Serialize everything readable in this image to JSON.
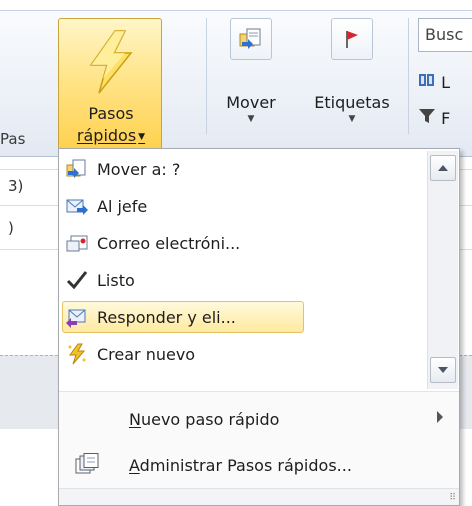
{
  "ribbon": {
    "quick_steps_button": {
      "line1": "Pasos",
      "line2": "rápidos"
    },
    "move_button": {
      "label": "Mover",
      "icon": "move-folder-icon"
    },
    "tags_button": {
      "label": "Etiquetas",
      "icon": "red-flag-icon"
    },
    "group_label": "Pas",
    "search_box": "Busc",
    "side_items": [
      {
        "label": "L",
        "icon": "address-book-icon"
      },
      {
        "label": "F",
        "icon": "filter-icon"
      }
    ]
  },
  "background_rows": [
    "3)",
    ")"
  ],
  "quick_steps_menu": {
    "gallery_items": [
      {
        "label": "Mover a: ?",
        "icon": "move-to-folder-icon"
      },
      {
        "label": "Al jefe",
        "icon": "forward-mail-icon"
      },
      {
        "label": "Correo electróni...",
        "icon": "team-email-icon"
      },
      {
        "label": "Listo",
        "icon": "checkmark-icon"
      },
      {
        "label": "Responder y eli...",
        "icon": "reply-delete-icon",
        "highlighted": true
      },
      {
        "label": "Crear nuevo",
        "icon": "lightning-new-icon"
      }
    ],
    "menu_items": [
      {
        "mnemonic": "N",
        "rest": "uevo paso rápido",
        "has_submenu": true
      },
      {
        "mnemonic": "A",
        "rest": "dministrar Pasos rápidos...",
        "icon": "manage-quick-steps-icon"
      }
    ]
  },
  "colors": {
    "highlight_gold": "#ffd24f",
    "ribbon_bg": "#e3e9f3",
    "flag_red": "#d6262b",
    "check_gray": "#333333"
  }
}
